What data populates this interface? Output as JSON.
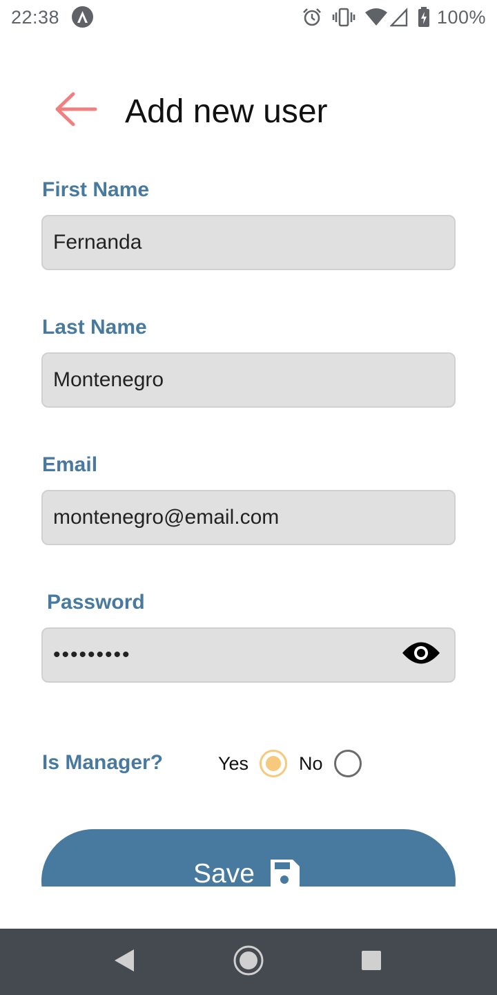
{
  "status_bar": {
    "time": "22:38",
    "battery": "100%",
    "icons": [
      "app-notification-icon",
      "alarm-icon",
      "vibrate-icon",
      "wifi-icon",
      "cell-signal-icon",
      "battery-charging-icon"
    ]
  },
  "header": {
    "title": "Add new user",
    "back_icon": "arrow-left-icon"
  },
  "form": {
    "first_name": {
      "label": "First Name",
      "value": "Fernanda"
    },
    "last_name": {
      "label": "Last Name",
      "value": "Montenegro"
    },
    "email": {
      "label": "Email",
      "value": "montenegro@email.com"
    },
    "password": {
      "label": "Password",
      "value": "•••••••••",
      "toggle_icon": "eye-icon"
    },
    "is_manager": {
      "label": "Is Manager?",
      "options": [
        {
          "label": "Yes",
          "selected": true
        },
        {
          "label": "No",
          "selected": false
        }
      ]
    }
  },
  "save_button": {
    "label": "Save",
    "icon": "floppy-disk-icon"
  },
  "nav_bar": {
    "icons": [
      "back-triangle-icon",
      "home-circle-icon",
      "recents-square-icon"
    ]
  },
  "colors": {
    "accent": "#477a9e",
    "back_arrow": "#f08080",
    "radio_selected": "#f6c97c",
    "input_background": "#e0e0e0",
    "nav_bar": "#454a50"
  }
}
